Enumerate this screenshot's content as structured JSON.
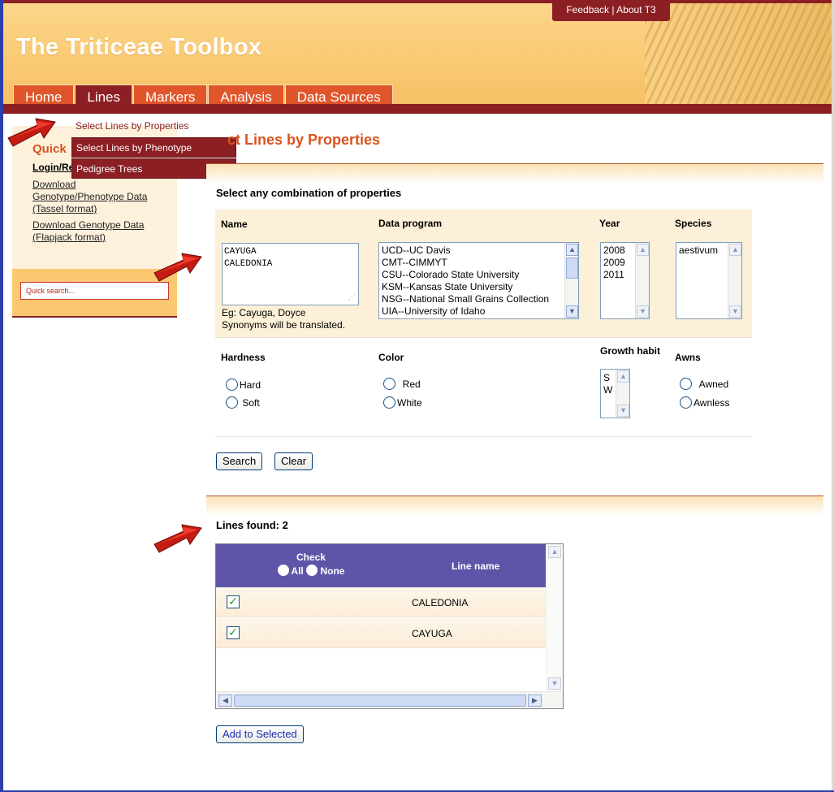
{
  "header": {
    "site_title": "The Triticeae Toolbox",
    "feedback_link": "Feedback | About T3",
    "nav_tabs": [
      "Home",
      "Lines",
      "Markers",
      "Analysis",
      "Data Sources"
    ]
  },
  "dropdown": {
    "items": [
      "Select Lines by Properties",
      "Select Lines by Phenotype",
      "Pedigree Trees"
    ]
  },
  "sidebar": {
    "title": "Quick",
    "login": "Login/Re",
    "link1": [
      "Download",
      "Genotype/Phenotype Data",
      "(Tassel format)"
    ],
    "link2": [
      "Download Genotype Data",
      "(Flapjack format)"
    ],
    "quick_search_placeholder": "Quick search..."
  },
  "main": {
    "page_title": "ct Lines by Properties",
    "subhead": "Select any combination of properties",
    "labels": {
      "name": "Name",
      "data_program": "Data program",
      "year": "Year",
      "species": "Species",
      "hardness": "Hardness",
      "color": "Color",
      "growth_habit": "Growth habit",
      "awns": "Awns"
    },
    "name_values": [
      "CAYUGA",
      "CALEDONIA"
    ],
    "name_hint": [
      "Eg: Cayuga, Doyce",
      "Synonyms will be translated."
    ],
    "data_programs": [
      "UCD--UC Davis",
      "CMT--CIMMYT",
      "CSU--Colorado State University",
      "KSM--Kansas State University",
      "NSG--National Small Grains Collection",
      "UIA--University of Idaho"
    ],
    "years": [
      "2008",
      "2009",
      "2011"
    ],
    "species": [
      "aestivum"
    ],
    "growth_habits": [
      "S",
      "W"
    ],
    "hardness_options": [
      "Hard",
      "Soft"
    ],
    "color_options": [
      "Red",
      "White"
    ],
    "awns_options": [
      "Awned",
      "Awnless"
    ],
    "search_button": "Search",
    "clear_button": "Clear"
  },
  "results": {
    "found_label": "Lines found: 2",
    "col_check": "Check",
    "all_label": "All",
    "none_label": "None",
    "col_line_name": "Line name",
    "rows": [
      {
        "checked": true,
        "name": "CALEDONIA"
      },
      {
        "checked": true,
        "name": "CAYUGA"
      }
    ],
    "add_button": "Add to Selected"
  },
  "colors": {
    "header_orange": "#f9c870",
    "tab_orange": "#e0562a",
    "dark_red": "#8b1f24",
    "title_orange": "#d9541e",
    "table_header": "#5e55a8"
  }
}
